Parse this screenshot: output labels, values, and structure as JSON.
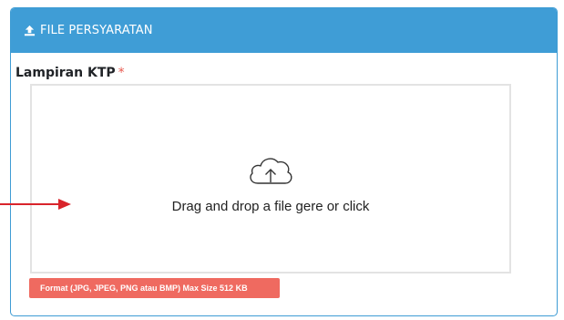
{
  "panel": {
    "header_title": "FILE PERSYARATAN",
    "header_icon": "upload-icon"
  },
  "field": {
    "label": "Lampiran KTP",
    "required_marker": "*"
  },
  "dropzone": {
    "icon": "cloud-upload-icon",
    "message": "Drag and drop a file gere or click"
  },
  "format_hint": "Format (JPG, JPEG, PNG atau BMP) Max Size 512 KB",
  "colors": {
    "header_bg": "#3f9dd6",
    "border": "#3e9cd4",
    "required": "#e8594f",
    "badge_bg": "#ef6a60",
    "annotation_arrow": "#d9242b"
  }
}
